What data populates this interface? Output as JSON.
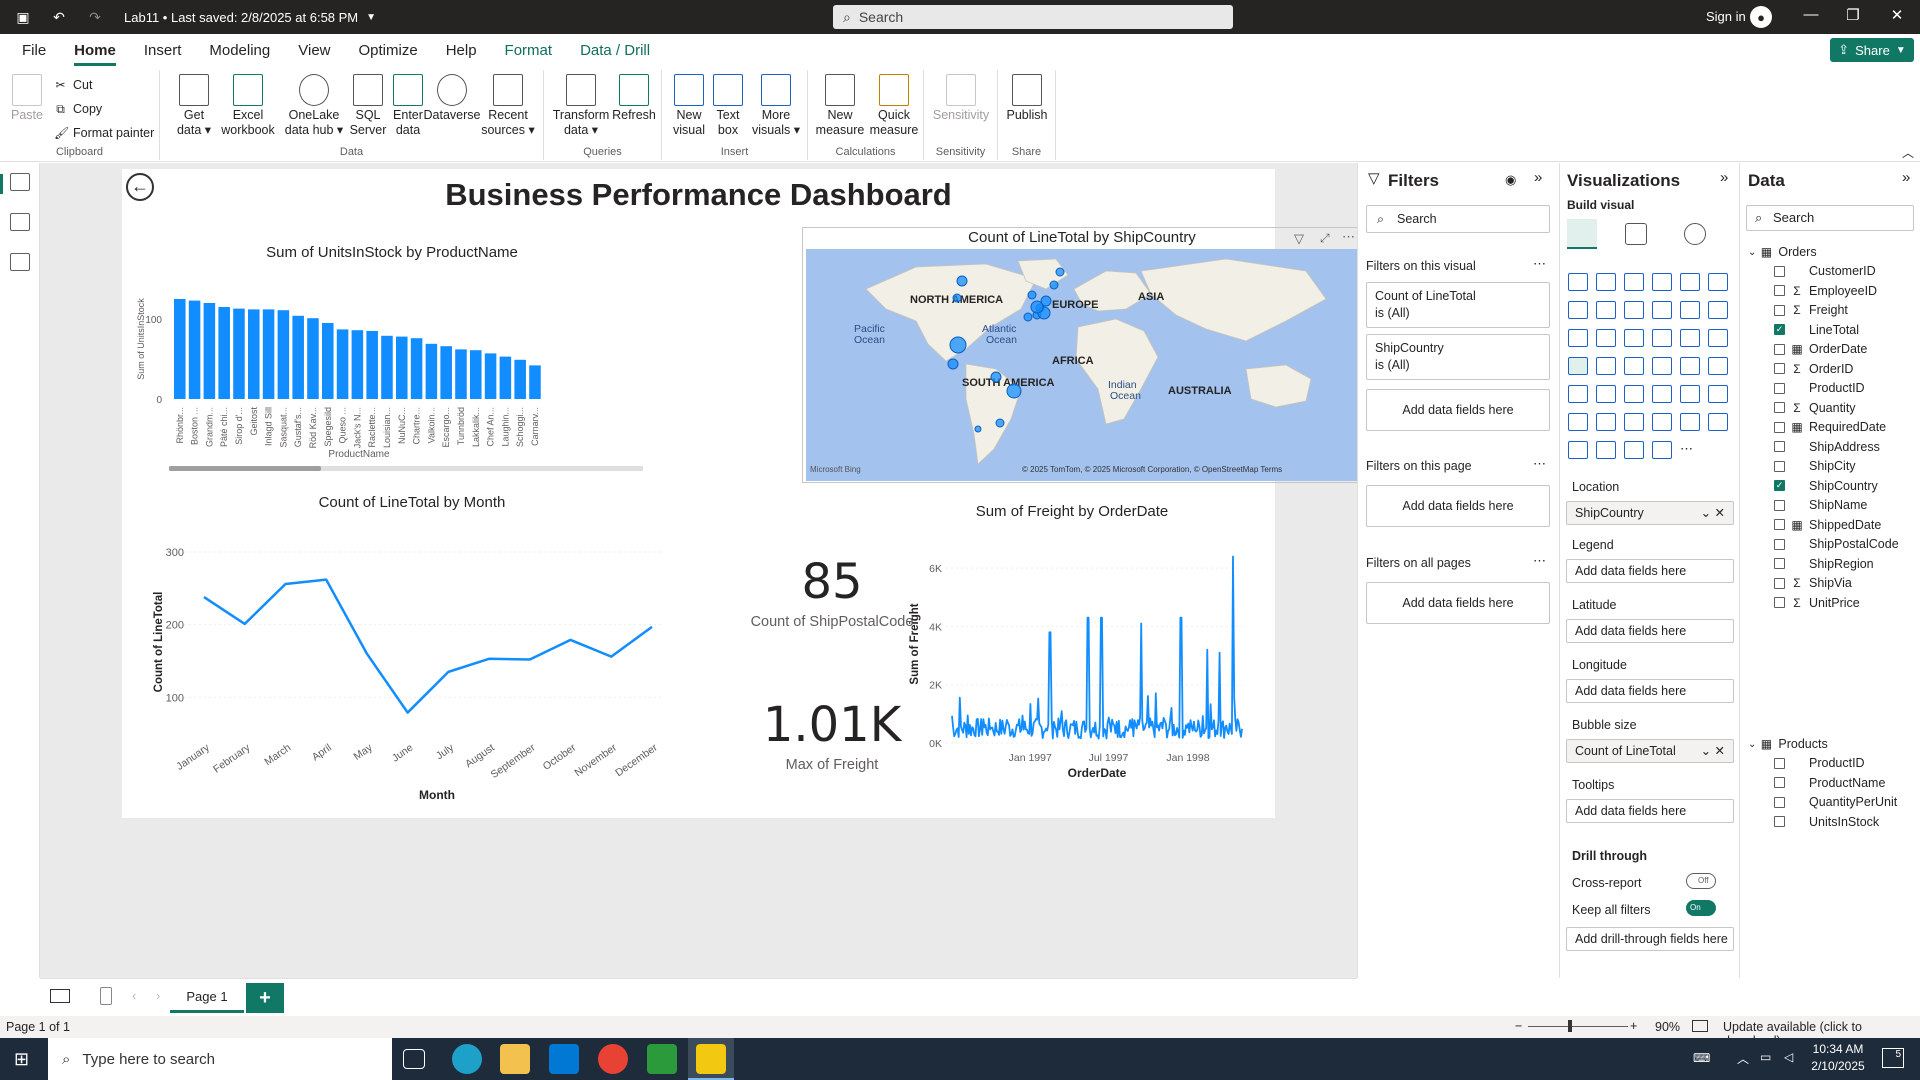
{
  "titlebar": {
    "doc_title": "Lab11 • Last saved: 2/8/2025 at 6:58 PM",
    "search_placeholder": "Search",
    "signin": "Sign in"
  },
  "menu": {
    "tabs": [
      "File",
      "Home",
      "Insert",
      "Modeling",
      "View",
      "Optimize",
      "Help",
      "Format",
      "Data / Drill"
    ],
    "share": "Share"
  },
  "ribbon": {
    "clipboard": {
      "paste": "Paste",
      "cut": "Cut",
      "copy": "Copy",
      "format_painter": "Format painter",
      "label": "Clipboard"
    },
    "data": {
      "get_data": "Get data",
      "excel": "Excel workbook",
      "onelake": "OneLake data hub",
      "sql": "SQL Server",
      "enter": "Enter data",
      "dataverse": "Dataverse",
      "recent": "Recent sources",
      "label": "Data"
    },
    "queries": {
      "transform": "Transform data",
      "refresh": "Refresh",
      "label": "Queries"
    },
    "insert": {
      "new_visual": "New visual",
      "text_box": "Text box",
      "more_visuals": "More visuals",
      "label": "Insert"
    },
    "calculations": {
      "new_measure": "New measure",
      "quick_measure": "Quick measure",
      "label": "Calculations"
    },
    "sensitivity": {
      "sensitivity": "Sensitivity",
      "label": "Sensitivity"
    },
    "share": {
      "publish": "Publish",
      "label": "Share"
    }
  },
  "report": {
    "title": "Business Performance Dashboard",
    "bar_title": "Sum of UnitsInStock by ProductName",
    "map_title": "Count of LineTotal by ShipCountry",
    "line_title": "Count of LineTotal by Month",
    "freight_title": "Sum of Freight by OrderDate",
    "card1": {
      "value": "85",
      "label": "Count of ShipPostalCode"
    },
    "card2": {
      "value": "1.01K",
      "label": "Max of Freight"
    },
    "map_labels": {
      "na": "NORTH AMERICA",
      "eu": "EUROPE",
      "asia": "ASIA",
      "af": "AFRICA",
      "sa": "SOUTH AMERICA",
      "au": "AUSTRALIA",
      "pac1": "Pacific",
      "pac2": "Ocean",
      "atl1": "Atlantic",
      "atl2": "Ocean",
      "ind1": "Indian",
      "ind2": "Ocean",
      "bing": "Microsoft Bing",
      "copy": "© 2025 TomTom, © 2025 Microsoft Corporation, © OpenStreetMap  Terms"
    }
  },
  "chart_data": [
    {
      "type": "bar",
      "title": "Sum of UnitsInStock by ProductName",
      "xlabel": "ProductName",
      "ylabel": "Sum of UnitsInStock",
      "yticks": [
        0,
        100
      ],
      "ylim": [
        0,
        150
      ],
      "categories": [
        "Rhönbr...",
        "Boston ...",
        "Grandm...",
        "Pâté chi...",
        "Sirop d'...",
        "Geitost",
        "Inlagd Sill",
        "Sasquat...",
        "Gustaf's...",
        "Röd Kav...",
        "Spegesild",
        "Queso ...",
        "Jack's N...",
        "Raclette...",
        "Louisian...",
        "NuNuC...",
        "Chartre...",
        "Valkoin...",
        "Escargo...",
        "Tunnbröd",
        "Lakkalik...",
        "Chef An...",
        "Laughin...",
        "Schoggi...",
        "Carnarv..."
      ],
      "values": [
        125,
        123,
        120,
        115,
        113,
        112,
        112,
        111,
        104,
        101,
        95,
        87,
        86,
        85,
        79,
        78,
        76,
        69,
        66,
        62,
        61,
        57,
        53,
        49,
        42
      ]
    },
    {
      "type": "line",
      "title": "Count of LineTotal by Month",
      "xlabel": "Month",
      "ylabel": "Count of LineTotal",
      "yticks": [
        100,
        200,
        300
      ],
      "ylim": [
        60,
        300
      ],
      "categories": [
        "January",
        "February",
        "March",
        "April",
        "May",
        "June",
        "July",
        "August",
        "September",
        "October",
        "November",
        "December"
      ],
      "values": [
        238,
        201,
        256,
        262,
        160,
        79,
        135,
        153,
        152,
        179,
        156,
        197
      ]
    },
    {
      "type": "line",
      "title": "Sum of Freight by OrderDate",
      "xlabel": "OrderDate",
      "ylabel": "Sum of Freight",
      "yticks": [
        "0K",
        "2K",
        "4K",
        "6K"
      ],
      "xticks": [
        "Jan 1997",
        "Jul 1997",
        "Jan 1998"
      ],
      "ylim": [
        0,
        6800
      ],
      "x_range": [
        "1996-07-04",
        "1998-05-06"
      ],
      "peaks": [
        {
          "x": "1997-02",
          "y": 3800
        },
        {
          "x": "1997-05",
          "y": 4300
        },
        {
          "x": "1997-06",
          "y": 4300
        },
        {
          "x": "1997-09",
          "y": 4100
        },
        {
          "x": "1997-12",
          "y": 4300
        },
        {
          "x": "1998-02",
          "y": 3200
        },
        {
          "x": "1998-03",
          "y": 3100
        },
        {
          "x": "1998-04",
          "y": 6400
        }
      ]
    },
    {
      "type": "map",
      "title": "Count of LineTotal by ShipCountry",
      "location": "ShipCountry",
      "bubble_size": "Count of LineTotal"
    }
  ],
  "filters": {
    "title": "Filters",
    "search": "Search",
    "on_visual": "Filters on this visual",
    "f1": "Count of LineTotal",
    "f1v": "is (All)",
    "f2": "ShipCountry",
    "f2v": "is (All)",
    "add": "Add data fields here",
    "on_page": "Filters on this page",
    "on_all": "Filters on all pages"
  },
  "viz": {
    "title": "Visualizations",
    "build": "Build visual",
    "location": "Location",
    "location_val": "ShipCountry",
    "legend": "Legend",
    "latitude": "Latitude",
    "longitude": "Longitude",
    "bubble": "Bubble size",
    "bubble_val": "Count of LineTotal",
    "tooltips": "Tooltips",
    "drill": "Drill through",
    "cross": "Cross-report",
    "keep": "Keep all filters",
    "add": "Add data fields here",
    "add_drill": "Add drill-through fields here",
    "off": "Off",
    "on": "On"
  },
  "data": {
    "title": "Data",
    "search": "Search",
    "orders": "Orders",
    "products": "Products",
    "order_fields": [
      {
        "n": "CustomerID",
        "s": "",
        "c": false
      },
      {
        "n": "EmployeeID",
        "s": "Σ",
        "c": false
      },
      {
        "n": "Freight",
        "s": "Σ",
        "c": false
      },
      {
        "n": "LineTotal",
        "s": "",
        "c": true
      },
      {
        "n": "OrderDate",
        "s": "▦",
        "c": false
      },
      {
        "n": "OrderID",
        "s": "Σ",
        "c": false
      },
      {
        "n": "ProductID",
        "s": "",
        "c": false
      },
      {
        "n": "Quantity",
        "s": "Σ",
        "c": false
      },
      {
        "n": "RequiredDate",
        "s": "▦",
        "c": false
      },
      {
        "n": "ShipAddress",
        "s": "",
        "c": false
      },
      {
        "n": "ShipCity",
        "s": "",
        "c": false
      },
      {
        "n": "ShipCountry",
        "s": "",
        "c": true
      },
      {
        "n": "ShipName",
        "s": "",
        "c": false
      },
      {
        "n": "ShippedDate",
        "s": "▦",
        "c": false
      },
      {
        "n": "ShipPostalCode",
        "s": "",
        "c": false
      },
      {
        "n": "ShipRegion",
        "s": "",
        "c": false
      },
      {
        "n": "ShipVia",
        "s": "Σ",
        "c": false
      },
      {
        "n": "UnitPrice",
        "s": "Σ",
        "c": false
      }
    ],
    "product_fields": [
      {
        "n": "ProductID",
        "s": "",
        "c": false
      },
      {
        "n": "ProductName",
        "s": "",
        "c": false
      },
      {
        "n": "QuantityPerUnit",
        "s": "",
        "c": false
      },
      {
        "n": "UnitsInStock",
        "s": "",
        "c": false
      }
    ]
  },
  "pagebar": {
    "page1": "Page 1",
    "add": "+"
  },
  "status": {
    "page": "Page 1 of 1",
    "zoom": "90%",
    "update": "Update available (click to download)"
  },
  "taskbar": {
    "search": "Type here to search",
    "time": "10:34 AM",
    "date": "2/10/2025",
    "notif": "5"
  },
  "colors": {
    "accent": "#117865",
    "bar": "#118dff",
    "map_water": "#a3c2ee"
  }
}
